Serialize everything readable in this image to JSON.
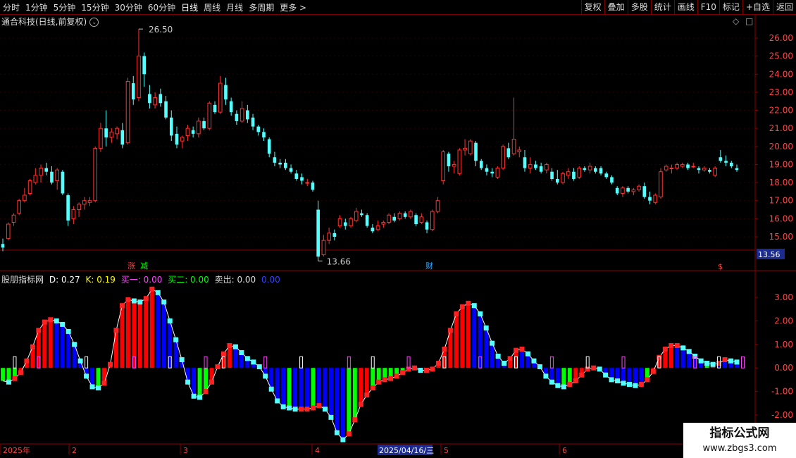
{
  "toolbar": {
    "periods": [
      "分时",
      "1分钟",
      "5分钟",
      "15分钟",
      "30分钟",
      "60分钟",
      "日线",
      "周线",
      "月线",
      "多周期",
      "更多 >"
    ],
    "tools": [
      "复权",
      "叠加",
      "多股",
      "统计",
      "画线",
      "F10",
      "标记",
      "+自选",
      "返回"
    ]
  },
  "chart_title": "通合科技(日线,前复权)",
  "price_axis": {
    "labels": [
      "26.00",
      "25.00",
      "24.00",
      "23.00",
      "22.00",
      "21.00",
      "20.00",
      "19.00",
      "18.00",
      "17.00",
      "16.00",
      "15.00"
    ],
    "current_price": "13.56"
  },
  "annotations": {
    "high": "26.50",
    "low": "13.66",
    "marker_zhang": "涨",
    "marker_jian": "减",
    "marker_cai": "财",
    "marker_s": "$"
  },
  "indicator": {
    "name": "股朋指标网",
    "d_label": "D: 0.27",
    "k_label": "K: 0.19",
    "buy1_label": "买一: 0.00",
    "buy2_label": "买二: 0.00",
    "sell_label": "卖出: 0.00",
    "extra_label": "0.00",
    "axis_labels": [
      "3.00",
      "2.00",
      "1.00",
      "0.00",
      "-1.00",
      "-2.00"
    ]
  },
  "time_axis": {
    "labels": [
      "2025年",
      "2",
      "3",
      "4",
      "2025/04/16/三",
      "5",
      "6"
    ]
  },
  "colors": {
    "bg": "#000000",
    "up": "#ff3232",
    "down": "#54ffff",
    "grid": "#8b0000",
    "bar_red": "#ff0000",
    "bar_blue": "#0000ff",
    "bar_green": "#00ff00",
    "bar_cyan": "#54ffff"
  },
  "chart_data": {
    "type": "candlestick",
    "candles": [
      [
        14.6,
        14.9,
        14.2,
        14.4
      ],
      [
        14.9,
        15.8,
        14.8,
        15.7
      ],
      [
        15.8,
        16.3,
        15.6,
        16.2
      ],
      [
        16.3,
        17.1,
        16.2,
        17.0
      ],
      [
        17.0,
        17.7,
        16.9,
        17.3
      ],
      [
        17.4,
        18.2,
        17.3,
        18.1
      ],
      [
        18.0,
        18.8,
        17.9,
        18.4
      ],
      [
        18.4,
        19.0,
        18.0,
        18.8
      ],
      [
        18.8,
        19.1,
        18.4,
        18.6
      ],
      [
        18.6,
        18.9,
        17.9,
        18.0
      ],
      [
        18.1,
        18.8,
        17.6,
        18.7
      ],
      [
        18.6,
        18.7,
        17.3,
        17.4
      ],
      [
        17.3,
        17.4,
        15.6,
        15.9
      ],
      [
        16.0,
        16.7,
        15.7,
        16.5
      ],
      [
        16.5,
        16.9,
        16.1,
        16.8
      ],
      [
        16.8,
        17.2,
        16.5,
        17.0
      ],
      [
        16.9,
        17.2,
        16.7,
        17.0
      ],
      [
        17.0,
        20.0,
        16.9,
        19.9
      ],
      [
        19.9,
        21.3,
        19.7,
        21.0
      ],
      [
        21.0,
        22.0,
        20.0,
        20.5
      ],
      [
        20.5,
        21.0,
        20.2,
        20.8
      ],
      [
        20.7,
        21.1,
        20.4,
        21.0
      ],
      [
        20.9,
        21.3,
        19.9,
        20.1
      ],
      [
        20.2,
        23.8,
        20.1,
        23.6
      ],
      [
        23.5,
        23.9,
        22.3,
        22.6
      ],
      [
        22.7,
        26.5,
        22.5,
        25.0
      ],
      [
        25.0,
        25.2,
        23.3,
        24.0
      ],
      [
        22.9,
        23.4,
        22.1,
        22.4
      ],
      [
        22.3,
        23.0,
        22.1,
        22.7
      ],
      [
        22.9,
        23.2,
        22.2,
        22.4
      ],
      [
        22.5,
        22.8,
        21.5,
        21.6
      ],
      [
        21.6,
        22.0,
        20.3,
        20.6
      ],
      [
        20.7,
        21.1,
        19.9,
        20.1
      ],
      [
        20.3,
        20.6,
        19.9,
        20.5
      ],
      [
        20.6,
        21.2,
        20.3,
        21.0
      ],
      [
        20.9,
        21.1,
        20.5,
        20.7
      ],
      [
        20.7,
        21.6,
        20.5,
        21.4
      ],
      [
        21.4,
        21.6,
        20.9,
        21.0
      ],
      [
        21.0,
        22.5,
        20.9,
        22.4
      ],
      [
        22.3,
        22.5,
        21.8,
        21.9
      ],
      [
        21.9,
        23.9,
        21.8,
        23.5
      ],
      [
        23.4,
        23.8,
        22.3,
        22.6
      ],
      [
        22.5,
        22.7,
        21.7,
        21.9
      ],
      [
        21.8,
        22.0,
        21.2,
        21.4
      ],
      [
        21.4,
        22.5,
        21.3,
        22.1
      ],
      [
        22.0,
        22.3,
        21.3,
        21.5
      ],
      [
        21.6,
        21.8,
        20.9,
        21.1
      ],
      [
        21.1,
        21.2,
        20.6,
        20.8
      ],
      [
        20.8,
        21.0,
        20.3,
        20.5
      ],
      [
        20.4,
        20.5,
        19.4,
        19.6
      ],
      [
        19.4,
        19.7,
        18.9,
        19.1
      ],
      [
        19.1,
        19.3,
        18.8,
        19.0
      ],
      [
        19.1,
        19.3,
        18.7,
        18.8
      ],
      [
        18.8,
        19.0,
        18.5,
        18.6
      ],
      [
        18.5,
        18.7,
        18.1,
        18.2
      ],
      [
        18.3,
        18.5,
        17.9,
        18.1
      ],
      [
        18.0,
        18.2,
        17.8,
        18.0
      ],
      [
        18.0,
        18.1,
        17.5,
        17.6
      ],
      [
        16.5,
        17.0,
        13.66,
        13.9
      ],
      [
        14.0,
        15.1,
        13.9,
        14.8
      ],
      [
        14.8,
        15.5,
        14.6,
        15.2
      ],
      [
        15.2,
        15.4,
        14.8,
        15.0
      ],
      [
        15.6,
        16.2,
        15.5,
        16.0
      ],
      [
        15.8,
        16.0,
        15.4,
        15.6
      ],
      [
        15.6,
        16.1,
        15.5,
        16.0
      ],
      [
        15.9,
        16.6,
        15.8,
        16.4
      ],
      [
        16.3,
        16.5,
        16.1,
        16.2
      ],
      [
        16.2,
        16.3,
        15.5,
        15.6
      ],
      [
        15.5,
        15.7,
        15.2,
        15.3
      ],
      [
        15.4,
        15.9,
        15.3,
        15.6
      ],
      [
        15.7,
        15.9,
        15.5,
        15.8
      ],
      [
        15.8,
        16.3,
        15.7,
        16.2
      ],
      [
        16.1,
        16.3,
        15.8,
        15.9
      ],
      [
        16.0,
        16.4,
        15.9,
        16.3
      ],
      [
        16.3,
        16.4,
        16.0,
        16.1
      ],
      [
        16.1,
        16.5,
        16.0,
        16.4
      ],
      [
        16.2,
        16.3,
        15.6,
        15.7
      ],
      [
        15.8,
        16.3,
        15.7,
        16.1
      ],
      [
        15.8,
        15.9,
        15.2,
        15.4
      ],
      [
        15.4,
        16.5,
        15.3,
        16.4
      ],
      [
        16.4,
        17.2,
        16.3,
        17.0
      ],
      [
        18.1,
        19.8,
        17.9,
        19.7
      ],
      [
        19.6,
        19.7,
        18.6,
        18.9
      ],
      [
        18.9,
        19.2,
        18.5,
        19.0
      ],
      [
        18.5,
        19.9,
        18.4,
        19.8
      ],
      [
        19.8,
        20.4,
        19.5,
        19.9
      ],
      [
        19.6,
        20.4,
        19.5,
        20.3
      ],
      [
        20.2,
        20.3,
        18.9,
        19.2
      ],
      [
        19.2,
        19.3,
        18.7,
        18.8
      ],
      [
        18.8,
        19.0,
        18.4,
        18.6
      ],
      [
        18.6,
        18.8,
        18.3,
        18.5
      ],
      [
        18.3,
        18.9,
        18.2,
        18.8
      ],
      [
        18.8,
        20.1,
        18.7,
        20.0
      ],
      [
        19.9,
        20.2,
        19.3,
        19.4
      ],
      [
        19.6,
        22.7,
        19.5,
        20.4
      ],
      [
        19.7,
        20.0,
        19.4,
        19.8
      ],
      [
        19.4,
        19.8,
        18.6,
        18.8
      ],
      [
        18.8,
        19.4,
        18.5,
        19.0
      ],
      [
        19.0,
        19.2,
        18.7,
        18.8
      ],
      [
        18.9,
        19.1,
        18.5,
        18.6
      ],
      [
        18.7,
        19.1,
        18.5,
        19.0
      ],
      [
        18.6,
        18.8,
        18.1,
        18.2
      ],
      [
        18.2,
        18.7,
        17.9,
        18.0
      ],
      [
        18.0,
        18.6,
        17.9,
        18.5
      ],
      [
        18.4,
        18.8,
        18.2,
        18.6
      ],
      [
        18.6,
        18.8,
        18.1,
        18.2
      ],
      [
        18.3,
        18.9,
        18.2,
        18.8
      ],
      [
        18.8,
        18.9,
        18.6,
        18.7
      ],
      [
        18.7,
        19.1,
        18.5,
        18.9
      ],
      [
        18.8,
        18.9,
        18.5,
        18.6
      ],
      [
        18.8,
        18.9,
        18.4,
        18.5
      ],
      [
        18.5,
        18.6,
        18.2,
        18.3
      ],
      [
        18.3,
        18.4,
        17.9,
        18.0
      ],
      [
        17.7,
        17.8,
        17.3,
        17.4
      ],
      [
        17.4,
        17.8,
        17.2,
        17.7
      ],
      [
        17.7,
        17.8,
        17.4,
        17.5
      ],
      [
        17.5,
        17.7,
        17.3,
        17.6
      ],
      [
        17.6,
        17.9,
        17.5,
        17.8
      ],
      [
        17.8,
        18.0,
        17.1,
        17.2
      ],
      [
        17.2,
        17.5,
        16.8,
        17.0
      ],
      [
        16.9,
        17.4,
        16.8,
        17.3
      ],
      [
        17.2,
        18.8,
        17.1,
        18.6
      ],
      [
        18.7,
        19.0,
        18.6,
        18.9
      ],
      [
        18.8,
        19.0,
        18.5,
        18.8
      ],
      [
        18.8,
        19.1,
        18.7,
        19.0
      ],
      [
        18.9,
        19.1,
        18.8,
        19.0
      ],
      [
        19.0,
        19.1,
        18.7,
        18.8
      ],
      [
        18.9,
        19.1,
        18.8,
        18.9
      ],
      [
        18.8,
        18.9,
        18.5,
        18.7
      ],
      [
        18.7,
        18.9,
        18.6,
        18.8
      ],
      [
        18.7,
        18.8,
        18.5,
        18.6
      ],
      [
        18.4,
        18.9,
        18.3,
        18.8
      ],
      [
        19.4,
        19.8,
        19.1,
        19.2
      ],
      [
        19.2,
        19.5,
        18.9,
        19.1
      ],
      [
        19.1,
        19.2,
        18.8,
        18.9
      ],
      [
        18.8,
        19.0,
        18.6,
        18.7
      ]
    ],
    "indicator_values": [
      -0.55,
      -0.6,
      -0.45,
      -0.2,
      0.3,
      0.9,
      1.6,
      1.95,
      2.05,
      2.0,
      1.85,
      1.55,
      1.0,
      0.3,
      -0.35,
      -0.8,
      -0.85,
      -0.65,
      0.15,
      1.6,
      2.65,
      2.9,
      2.85,
      2.8,
      2.95,
      3.35,
      3.2,
      2.8,
      2.0,
      1.2,
      0.35,
      -0.6,
      -1.2,
      -1.25,
      -1.0,
      -0.6,
      0.05,
      0.6,
      0.95,
      0.9,
      0.65,
      0.4,
      0.25,
      0.05,
      -0.35,
      -0.9,
      -1.4,
      -1.65,
      -1.7,
      -1.75,
      -1.75,
      -1.75,
      -1.7,
      -1.6,
      -1.75,
      -2.1,
      -2.75,
      -3.05,
      -2.8,
      -2.2,
      -1.55,
      -1.15,
      -0.85,
      -0.6,
      -0.5,
      -0.45,
      -0.35,
      -0.2,
      -0.05,
      0.0,
      -0.1,
      -0.1,
      -0.05,
      0.2,
      0.8,
      1.6,
      2.3,
      2.6,
      2.75,
      2.65,
      2.3,
      1.7,
      1.05,
      0.5,
      0.2,
      0.4,
      0.75,
      0.8,
      0.6,
      0.3,
      0.05,
      -0.35,
      -0.6,
      -0.75,
      -0.8,
      -0.7,
      -0.55,
      -0.3,
      -0.05,
      0.0,
      -0.05,
      -0.3,
      -0.5,
      -0.55,
      -0.65,
      -0.7,
      -0.75,
      -0.7,
      -0.5,
      -0.15,
      0.45,
      0.8,
      0.95,
      0.95,
      0.85,
      0.7,
      0.5,
      0.3,
      0.2,
      0.15,
      0.2,
      0.35,
      0.3,
      0.25
    ],
    "indicator_bar_colors": [
      "g",
      "g",
      "g",
      "r",
      "r",
      "r",
      "r",
      "r",
      "r",
      "b",
      "b",
      "b",
      "b",
      "b",
      "b",
      "b",
      "g",
      "r",
      "r",
      "r",
      "r",
      "r",
      "r",
      "r",
      "r",
      "r",
      "b",
      "b",
      "b",
      "b",
      "b",
      "b",
      "b",
      "g",
      "g",
      "r",
      "r",
      "r",
      "r",
      "b",
      "b",
      "b",
      "b",
      "b",
      "b",
      "b",
      "b",
      "b",
      "g",
      "b",
      "b",
      "b",
      "g",
      "b",
      "b",
      "b",
      "b",
      "b",
      "g",
      "g",
      "r",
      "r",
      "g",
      "g",
      "g",
      "g",
      "g",
      "g",
      "g",
      "g",
      "b",
      "b",
      "g",
      "r",
      "r",
      "r",
      "r",
      "r",
      "r",
      "b",
      "b",
      "b",
      "b",
      "b",
      "b",
      "r",
      "r",
      "b",
      "b",
      "b",
      "b",
      "b",
      "b",
      "b",
      "g",
      "g",
      "r",
      "r",
      "r",
      "g",
      "b",
      "b",
      "b",
      "b",
      "b",
      "b",
      "b",
      "b",
      "g",
      "r",
      "r",
      "r",
      "r",
      "b",
      "b",
      "b",
      "b",
      "b",
      "g",
      "r",
      "b",
      "b",
      "b"
    ]
  }
}
